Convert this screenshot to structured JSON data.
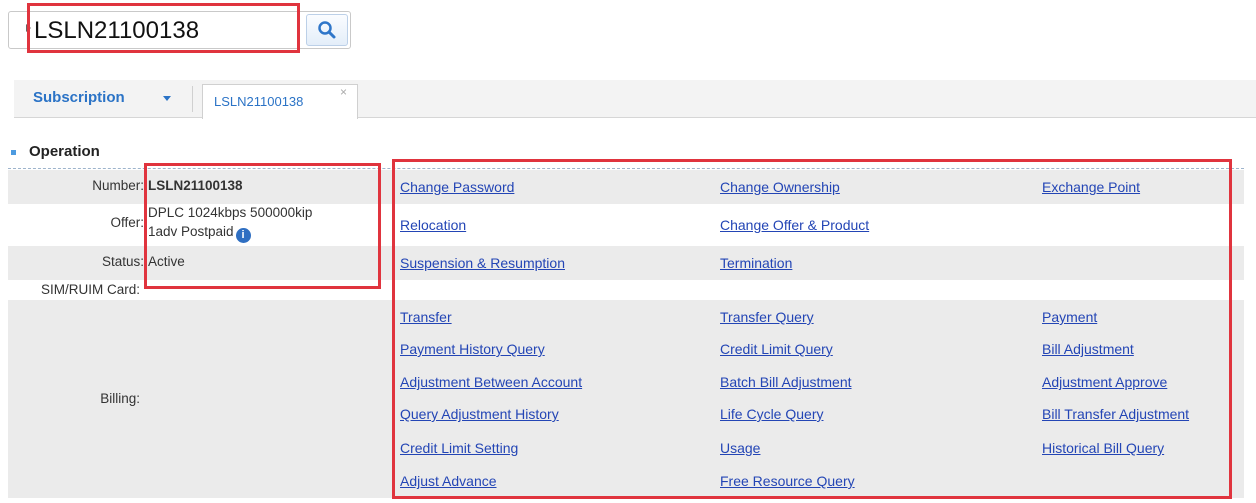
{
  "search": {
    "value": "LSLN21100138",
    "button_icon": "search-icon"
  },
  "tabs": {
    "menu_label": "Subscription",
    "active_label": "LSLN21100138",
    "close_glyph": "×"
  },
  "section": {
    "title": "Operation"
  },
  "info": {
    "number_label": "Number:",
    "number_value": "LSLN21100138",
    "offer_label": "Offer:",
    "offer_line1": "DPLC 1024kbps 500000kip",
    "offer_line2": "1adv Postpaid",
    "status_label": "Status:",
    "status_value": "Active",
    "sim_label": "SIM/RUIM Card:",
    "billing_label": "Billing:"
  },
  "operations": {
    "change_password": "Change Password",
    "change_ownership": "Change Ownership",
    "exchange_point": "Exchange Point",
    "relocation": "Relocation",
    "change_offer": "Change Offer & Product",
    "suspension": "Suspension & Resumption",
    "termination": "Termination"
  },
  "billing": {
    "transfer": "Transfer",
    "transfer_query": "Transfer Query",
    "payment": "Payment",
    "payment_history": "Payment History Query",
    "credit_limit_query": "Credit Limit Query",
    "bill_adjustment": "Bill Adjustment",
    "adjustment_between": "Adjustment Between Account",
    "batch_bill_adjustment": "Batch Bill Adjustment",
    "adjustment_approve": "Adjustment Approve",
    "query_adjustment_history": "Query Adjustment History",
    "life_cycle_query": "Life Cycle Query",
    "bill_transfer_adjustment": "Bill Transfer Adjustment",
    "credit_limit_setting": "Credit Limit Setting",
    "usage": "Usage",
    "historical_bill_query": "Historical Bill Query",
    "adjust_advance": "Adjust Advance",
    "free_resource_query": "Free Resource Query"
  },
  "colors": {
    "link": "#2345b5",
    "tab_text": "#2b73c6",
    "highlight": "#e0343e",
    "row_shade": "#ebebeb"
  }
}
